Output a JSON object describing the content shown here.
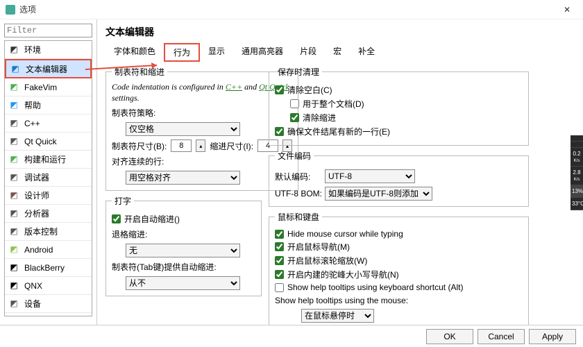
{
  "window": {
    "title": "选项"
  },
  "filter": {
    "placeholder": "Filter"
  },
  "categories": [
    {
      "id": "env",
      "label": "环境",
      "iconColor": "#333"
    },
    {
      "id": "texteditor",
      "label": "文本编辑器",
      "iconColor": "#1976d2",
      "selected": true
    },
    {
      "id": "fakevim",
      "label": "FakeVim",
      "iconColor": "#4caf50"
    },
    {
      "id": "help",
      "label": "帮助",
      "iconColor": "#2196f3"
    },
    {
      "id": "cpp",
      "label": "C++",
      "iconColor": "#555"
    },
    {
      "id": "qtquick",
      "label": "Qt Quick",
      "iconColor": "#555"
    },
    {
      "id": "buildrun",
      "label": "构建和运行",
      "iconColor": "#4caf50"
    },
    {
      "id": "debugger",
      "label": "调试器",
      "iconColor": "#555"
    },
    {
      "id": "designer",
      "label": "设计师",
      "iconColor": "#795548"
    },
    {
      "id": "analyzer",
      "label": "分析器",
      "iconColor": "#555"
    },
    {
      "id": "vcs",
      "label": "版本控制",
      "iconColor": "#555"
    },
    {
      "id": "android",
      "label": "Android",
      "iconColor": "#8bc34a"
    },
    {
      "id": "blackberry",
      "label": "BlackBerry",
      "iconColor": "#000"
    },
    {
      "id": "qnx",
      "label": "QNX",
      "iconColor": "#000"
    },
    {
      "id": "devices",
      "label": "设备",
      "iconColor": "#555"
    }
  ],
  "header": {
    "title": "文本编辑器"
  },
  "tabs": {
    "items": [
      "字体和颜色",
      "行为",
      "显示",
      "通用高亮器",
      "片段",
      "宏",
      "补全"
    ],
    "activeIndex": 1
  },
  "tabsIndent": {
    "legend": "制表符和缩进",
    "note_pre": "Code indentation is configured in ",
    "link1": "C++",
    "note_mid": " and ",
    "link2": "Qt Quick",
    "note_post": " settings.",
    "policy_label": "制表符策略:",
    "policy_value": "仅空格",
    "tabsize_label": "制表符尺寸(B):",
    "tabsize_value": "8",
    "indentsize_label": "缩进尺寸(I):",
    "indentsize_value": "4",
    "align_label": "对齐连续的行:",
    "align_value": "用空格对齐"
  },
  "typing": {
    "legend": "打字",
    "autoindent_label": "开启自动缩进()",
    "autoindent_checked": true,
    "backspace_label": "退格缩进:",
    "backspace_value": "无",
    "tabkey_label": "制表符(Tab键)提供自动缩进:",
    "tabkey_value": "从不"
  },
  "cleanup": {
    "legend": "保存时清理",
    "clearblank_label": "清除空白(C)",
    "clearblank_checked": true,
    "wholedoc_label": "用于整个文档(D)",
    "wholedoc_checked": false,
    "clearindent_label": "清除缩进",
    "clearindent_checked": true,
    "newline_label": "确保文件结尾有新的一行(E)",
    "newline_checked": true
  },
  "encoding": {
    "legend": "文件编码",
    "default_label": "默认编码:",
    "default_value": "UTF-8",
    "bom_label": "UTF-8 BOM:",
    "bom_value": "如果编码是UTF-8则添加"
  },
  "mouse": {
    "legend": "鼠标和键盘",
    "hide_label": "Hide mouse cursor while typing",
    "hide_checked": true,
    "nav_label": "开启鼠标导航(M)",
    "nav_checked": true,
    "scroll_label": "开启鼠标滚轮缩放(W)",
    "scroll_checked": true,
    "camel_label": "开启内建的驼峰大小写导航(N)",
    "camel_checked": true,
    "tooltip_kb_label": "Show help tooltips using keyboard shortcut (Alt)",
    "tooltip_kb_checked": false,
    "tooltip_mouse_label": "Show help tooltips using the mouse:",
    "tooltip_mouse_value": "在鼠标悬停时"
  },
  "buttons": {
    "ok": "OK",
    "cancel": "Cancel",
    "apply": "Apply"
  },
  "widget": {
    "v1": "0.2",
    "u1": "K/s",
    "v2": "2.8",
    "u2": "K/s",
    "v3": "13%",
    "v4": "33°C"
  }
}
